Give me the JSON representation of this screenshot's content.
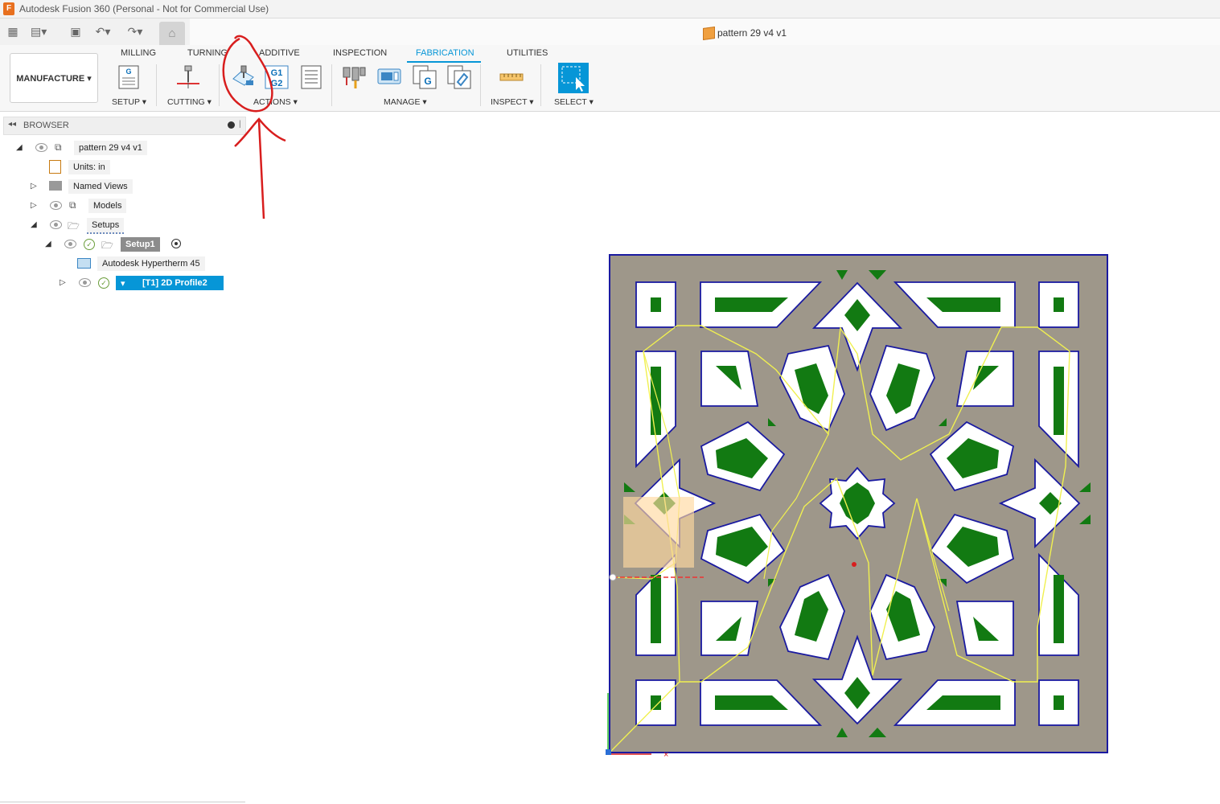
{
  "window": {
    "title": "Autodesk Fusion 360 (Personal - Not for Commercial Use)"
  },
  "document": {
    "name": "pattern 29 v4 v1"
  },
  "ribbon": {
    "workspace": "MANUFACTURE ▾",
    "tabs": [
      "MILLING",
      "TURNING",
      "ADDITIVE",
      "INSPECTION",
      "FABRICATION",
      "UTILITIES"
    ],
    "active_tab": "FABRICATION",
    "groups": {
      "setup": "SETUP ▾",
      "cutting": "CUTTING ▾",
      "actions": "ACTIONS ▾",
      "manage": "MANAGE ▾",
      "inspect": "INSPECT ▾",
      "select": "SELECT ▾"
    },
    "g1g2_label_top": "G1",
    "g1g2_label_bottom": "G2",
    "setup_icon_letter": "G",
    "manage_icon_letter": "G"
  },
  "browser": {
    "title": "BROWSER",
    "items": [
      {
        "label": "pattern 29 v4 v1"
      },
      {
        "label": "Units: in"
      },
      {
        "label": "Named Views"
      },
      {
        "label": "Models"
      },
      {
        "label": "Setups"
      },
      {
        "label": "Setup1"
      },
      {
        "label": "Autodesk Hypertherm 45"
      },
      {
        "label": "[T1] 2D Profile2"
      }
    ]
  },
  "colors": {
    "accent": "#0696d7",
    "plate": "#9e978a",
    "cutout_outline": "#1a1aa0",
    "green_fill": "#127a12",
    "toolpath": "#f0f050",
    "annotation": "#d81e1e"
  }
}
